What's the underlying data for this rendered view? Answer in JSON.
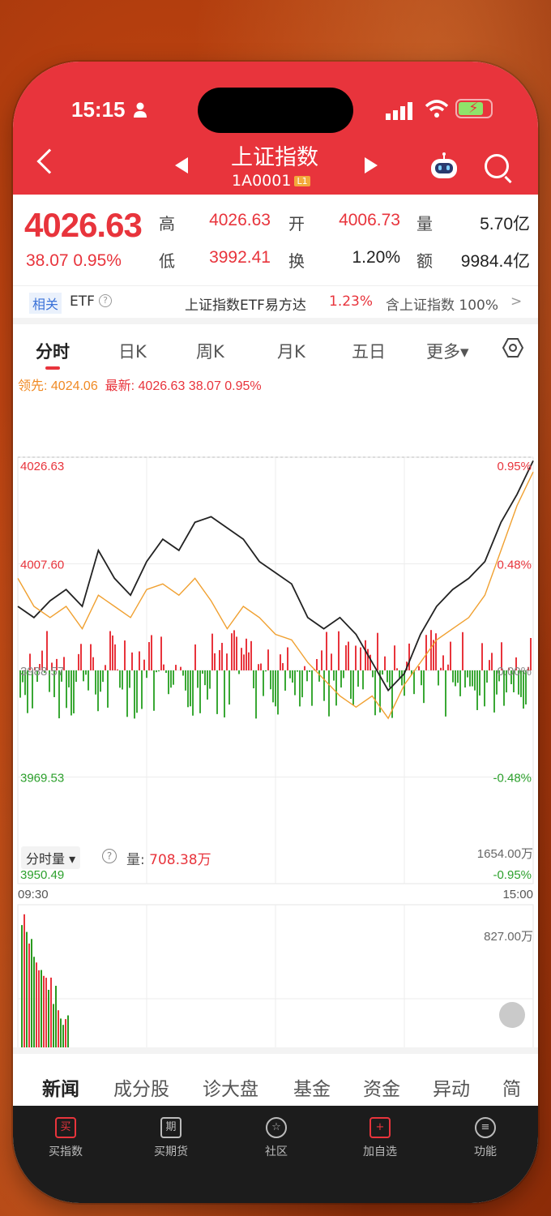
{
  "status": {
    "time": "15:15"
  },
  "header": {
    "title": "上证指数",
    "code": "1A0001",
    "level": "L1"
  },
  "quote": {
    "price": "4026.63",
    "change": "38.07  0.95%",
    "labels": {
      "high": "高",
      "open": "开",
      "volume": "量",
      "low": "低",
      "turnover": "换",
      "amount": "额"
    },
    "high": "4026.63",
    "open": "4006.73",
    "volume": "5.70亿",
    "low": "3992.41",
    "turnover_rate": "1.20%",
    "amount": "9984.4亿"
  },
  "etf": {
    "tag": "相关",
    "label": "ETF",
    "name": "上证指数ETF易方达",
    "pct": "1.23%",
    "hold": "含上证指数 100%",
    "chev": ">"
  },
  "tabs": [
    "分时",
    "日K",
    "周K",
    "月K",
    "五日",
    "更多▾"
  ],
  "lead": {
    "lead_label": "领先: 4024.06",
    "latest": "最新: 4026.63  38.07  0.95%"
  },
  "axis": {
    "y_left": [
      "4026.63",
      "4007.60",
      "3988.57",
      "3969.53",
      "3950.49"
    ],
    "y_right": [
      "0.95%",
      "0.48%",
      "0.00%",
      "-0.48%",
      "-0.95%"
    ],
    "x": [
      "09:30",
      "15:00"
    ]
  },
  "volume": {
    "selector": "分时量 ▾",
    "label": "量: ",
    "value": "708.38万",
    "max": "1654.00万",
    "mid": "827.00万"
  },
  "chart_data": {
    "type": "line",
    "x": [
      "09:30",
      "15:00"
    ],
    "ylim": [
      3950.49,
      4026.63
    ],
    "series": [
      {
        "values": [
          4000,
          3998,
          4001,
          4003,
          4000,
          4010,
          4005,
          4002,
          4008,
          4012,
          4010,
          4015,
          4016,
          4014,
          4012,
          4008,
          4006,
          4004,
          3998,
          3996,
          3998,
          3995,
          3990,
          3985,
          3988,
          3995,
          4000,
          4003,
          4005,
          4008,
          4015,
          4020,
          4026
        ]
      },
      {
        "values": [
          4005,
          4000,
          3998,
          4000,
          3996,
          4002,
          4000,
          3998,
          4003,
          4004,
          4002,
          4005,
          4001,
          3996,
          4000,
          3998,
          3995,
          3994,
          3990,
          3987,
          3984,
          3982,
          3984,
          3980,
          3986,
          3990,
          3994,
          3996,
          3998,
          4002,
          4010,
          4018,
          4024
        ]
      }
    ]
  },
  "news_tabs": [
    "新闻",
    "成分股",
    "诊大盘",
    "基金",
    "资金",
    "异动",
    "简况"
  ],
  "bottom_nav": [
    {
      "icon": "买",
      "label": "买指数"
    },
    {
      "icon": "期",
      "label": "买期货"
    },
    {
      "icon": "☆",
      "label": "社区"
    },
    {
      "icon": "+",
      "label": "加自选"
    },
    {
      "icon": "≡",
      "label": "功能"
    }
  ]
}
